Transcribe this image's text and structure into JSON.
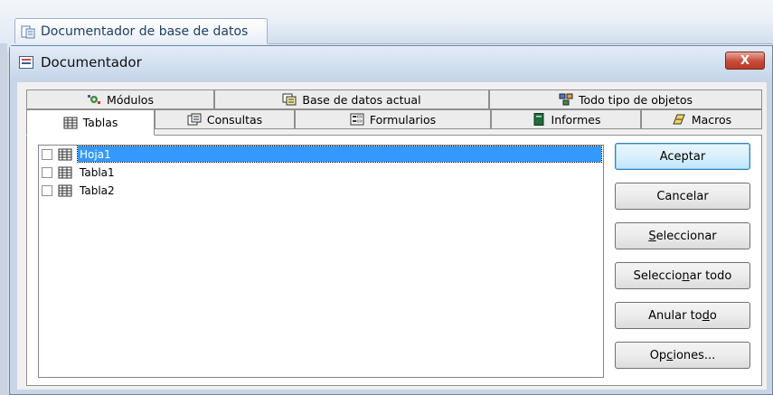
{
  "app": {
    "document_tab_title": "Documentador de base de datos"
  },
  "dialog": {
    "title": "Documentador",
    "close_label": "X"
  },
  "tabs": {
    "row_back": [
      {
        "label": "Módulos",
        "icon": "modules-icon"
      },
      {
        "label": "Base de datos actual",
        "icon": "database-icon"
      },
      {
        "label": "Todo tipo de objetos",
        "icon": "all-objects-icon"
      }
    ],
    "row_front": [
      {
        "label": "Tablas",
        "icon": "table-icon",
        "active": true
      },
      {
        "label": "Consultas",
        "icon": "query-icon"
      },
      {
        "label": "Formularios",
        "icon": "form-icon"
      },
      {
        "label": "Informes",
        "icon": "report-icon"
      },
      {
        "label": "Macros",
        "icon": "macro-icon"
      }
    ]
  },
  "objects": [
    {
      "name": "Hoja1",
      "checked": false,
      "selected": true
    },
    {
      "name": "Tabla1",
      "checked": false,
      "selected": false
    },
    {
      "name": "Tabla2",
      "checked": false,
      "selected": false
    }
  ],
  "buttons": {
    "ok": "Aceptar",
    "cancel": "Cancelar",
    "select_pre": "",
    "select_key": "S",
    "select_post": "eleccionar",
    "select_all_pre": "Seleccio",
    "select_all_key": "n",
    "select_all_post": "ar todo",
    "deselect_all_pre": "Anular to",
    "deselect_all_key": "d",
    "deselect_all_post": "o",
    "options_pre": "Op",
    "options_key": "c",
    "options_post": "iones..."
  },
  "colors": {
    "selection": "#3399ff",
    "close_button": "#c74a37",
    "titlebar": "#c6d6ea"
  }
}
